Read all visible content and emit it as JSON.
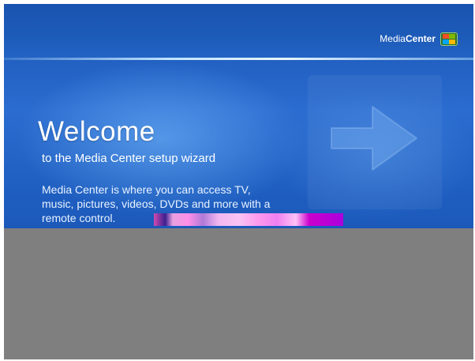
{
  "brand": {
    "prefix": "Media",
    "suffix": "Center",
    "logo_icon": "windows-flag-icon"
  },
  "wizard": {
    "title": "Welcome",
    "subtitle": "to the Media Center setup wizard",
    "description": "Media Center is where you can access TV, music, pictures, videos, DVDs and more with a remote control.",
    "next_icon": "right-arrow-icon"
  },
  "colors": {
    "background": "#1e5dbf",
    "accent_line": "#bfe3ff",
    "text": "#ffffff",
    "corrupted_area": "#7f7f7f"
  }
}
